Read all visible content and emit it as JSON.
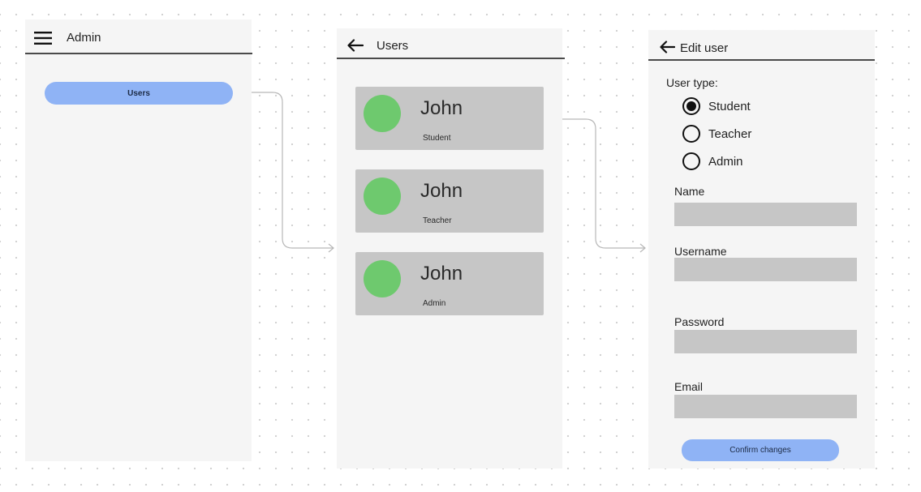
{
  "admin_screen": {
    "title": "Admin",
    "menu_icon": "hamburger-menu-icon",
    "nav_items": [
      {
        "label": "Users"
      }
    ]
  },
  "users_screen": {
    "title": "Users",
    "back_icon": "arrow-left-icon",
    "users": [
      {
        "name": "John",
        "role": "Student"
      },
      {
        "name": "John",
        "role": "Teacher"
      },
      {
        "name": "John",
        "role": "Admin"
      }
    ]
  },
  "edit_screen": {
    "title": "Edit user",
    "back_icon": "arrow-left-icon",
    "user_type_label": "User type:",
    "user_types": [
      {
        "label": "Student",
        "selected": true
      },
      {
        "label": "Teacher",
        "selected": false
      },
      {
        "label": "Admin",
        "selected": false
      }
    ],
    "fields": {
      "name": {
        "label": "Name",
        "value": ""
      },
      "username": {
        "label": "Username",
        "value": ""
      },
      "password": {
        "label": "Password",
        "value": ""
      },
      "email": {
        "label": "Email",
        "value": ""
      }
    },
    "confirm_label": "Confirm changes"
  },
  "colors": {
    "accent_pill": "#8fb3f5",
    "card": "#c6c6c6",
    "avatar": "#6ec96e",
    "screen_bg": "#f5f5f5"
  }
}
